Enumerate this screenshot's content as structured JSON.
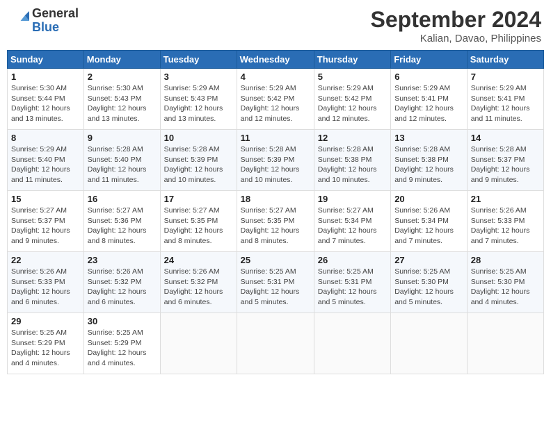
{
  "header": {
    "logo_general": "General",
    "logo_blue": "Blue",
    "month_title": "September 2024",
    "location": "Kalian, Davao, Philippines"
  },
  "weekdays": [
    "Sunday",
    "Monday",
    "Tuesday",
    "Wednesday",
    "Thursday",
    "Friday",
    "Saturday"
  ],
  "weeks": [
    [
      {
        "day": "1",
        "info": "Sunrise: 5:30 AM\nSunset: 5:44 PM\nDaylight: 12 hours\nand 13 minutes."
      },
      {
        "day": "2",
        "info": "Sunrise: 5:30 AM\nSunset: 5:43 PM\nDaylight: 12 hours\nand 13 minutes."
      },
      {
        "day": "3",
        "info": "Sunrise: 5:29 AM\nSunset: 5:43 PM\nDaylight: 12 hours\nand 13 minutes."
      },
      {
        "day": "4",
        "info": "Sunrise: 5:29 AM\nSunset: 5:42 PM\nDaylight: 12 hours\nand 12 minutes."
      },
      {
        "day": "5",
        "info": "Sunrise: 5:29 AM\nSunset: 5:42 PM\nDaylight: 12 hours\nand 12 minutes."
      },
      {
        "day": "6",
        "info": "Sunrise: 5:29 AM\nSunset: 5:41 PM\nDaylight: 12 hours\nand 12 minutes."
      },
      {
        "day": "7",
        "info": "Sunrise: 5:29 AM\nSunset: 5:41 PM\nDaylight: 12 hours\nand 11 minutes."
      }
    ],
    [
      {
        "day": "8",
        "info": "Sunrise: 5:29 AM\nSunset: 5:40 PM\nDaylight: 12 hours\nand 11 minutes."
      },
      {
        "day": "9",
        "info": "Sunrise: 5:28 AM\nSunset: 5:40 PM\nDaylight: 12 hours\nand 11 minutes."
      },
      {
        "day": "10",
        "info": "Sunrise: 5:28 AM\nSunset: 5:39 PM\nDaylight: 12 hours\nand 10 minutes."
      },
      {
        "day": "11",
        "info": "Sunrise: 5:28 AM\nSunset: 5:39 PM\nDaylight: 12 hours\nand 10 minutes."
      },
      {
        "day": "12",
        "info": "Sunrise: 5:28 AM\nSunset: 5:38 PM\nDaylight: 12 hours\nand 10 minutes."
      },
      {
        "day": "13",
        "info": "Sunrise: 5:28 AM\nSunset: 5:38 PM\nDaylight: 12 hours\nand 9 minutes."
      },
      {
        "day": "14",
        "info": "Sunrise: 5:28 AM\nSunset: 5:37 PM\nDaylight: 12 hours\nand 9 minutes."
      }
    ],
    [
      {
        "day": "15",
        "info": "Sunrise: 5:27 AM\nSunset: 5:37 PM\nDaylight: 12 hours\nand 9 minutes."
      },
      {
        "day": "16",
        "info": "Sunrise: 5:27 AM\nSunset: 5:36 PM\nDaylight: 12 hours\nand 8 minutes."
      },
      {
        "day": "17",
        "info": "Sunrise: 5:27 AM\nSunset: 5:35 PM\nDaylight: 12 hours\nand 8 minutes."
      },
      {
        "day": "18",
        "info": "Sunrise: 5:27 AM\nSunset: 5:35 PM\nDaylight: 12 hours\nand 8 minutes."
      },
      {
        "day": "19",
        "info": "Sunrise: 5:27 AM\nSunset: 5:34 PM\nDaylight: 12 hours\nand 7 minutes."
      },
      {
        "day": "20",
        "info": "Sunrise: 5:26 AM\nSunset: 5:34 PM\nDaylight: 12 hours\nand 7 minutes."
      },
      {
        "day": "21",
        "info": "Sunrise: 5:26 AM\nSunset: 5:33 PM\nDaylight: 12 hours\nand 7 minutes."
      }
    ],
    [
      {
        "day": "22",
        "info": "Sunrise: 5:26 AM\nSunset: 5:33 PM\nDaylight: 12 hours\nand 6 minutes."
      },
      {
        "day": "23",
        "info": "Sunrise: 5:26 AM\nSunset: 5:32 PM\nDaylight: 12 hours\nand 6 minutes."
      },
      {
        "day": "24",
        "info": "Sunrise: 5:26 AM\nSunset: 5:32 PM\nDaylight: 12 hours\nand 6 minutes."
      },
      {
        "day": "25",
        "info": "Sunrise: 5:25 AM\nSunset: 5:31 PM\nDaylight: 12 hours\nand 5 minutes."
      },
      {
        "day": "26",
        "info": "Sunrise: 5:25 AM\nSunset: 5:31 PM\nDaylight: 12 hours\nand 5 minutes."
      },
      {
        "day": "27",
        "info": "Sunrise: 5:25 AM\nSunset: 5:30 PM\nDaylight: 12 hours\nand 5 minutes."
      },
      {
        "day": "28",
        "info": "Sunrise: 5:25 AM\nSunset: 5:30 PM\nDaylight: 12 hours\nand 4 minutes."
      }
    ],
    [
      {
        "day": "29",
        "info": "Sunrise: 5:25 AM\nSunset: 5:29 PM\nDaylight: 12 hours\nand 4 minutes."
      },
      {
        "day": "30",
        "info": "Sunrise: 5:25 AM\nSunset: 5:29 PM\nDaylight: 12 hours\nand 4 minutes."
      },
      {
        "day": "",
        "info": ""
      },
      {
        "day": "",
        "info": ""
      },
      {
        "day": "",
        "info": ""
      },
      {
        "day": "",
        "info": ""
      },
      {
        "day": "",
        "info": ""
      }
    ]
  ]
}
